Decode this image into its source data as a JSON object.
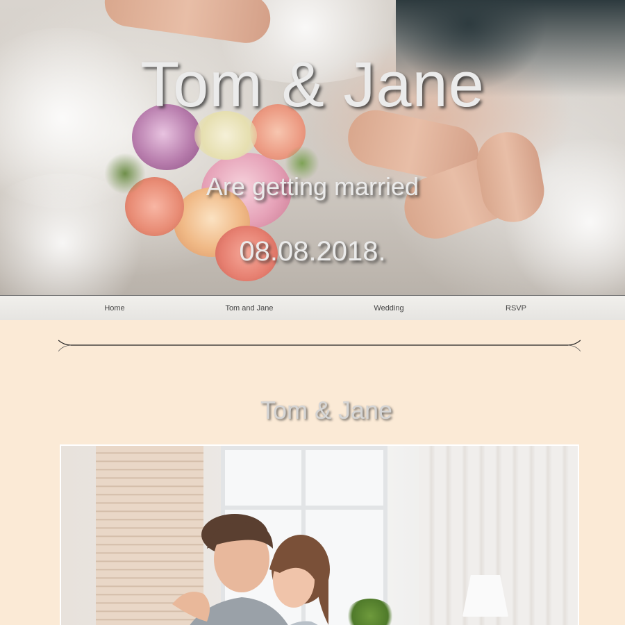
{
  "hero": {
    "names": "Tom & Jane",
    "subtitle": "Are getting married",
    "date": "08.08.2018."
  },
  "nav": {
    "items": [
      {
        "label": "Home"
      },
      {
        "label": "Tom and Jane"
      },
      {
        "label": "Wedding"
      },
      {
        "label": "RSVP"
      }
    ]
  },
  "section": {
    "title": "Tom & Jane"
  },
  "colors": {
    "page_background": "#fbead6",
    "title_text": "#ebebeb",
    "nav_background": "#ececea"
  }
}
